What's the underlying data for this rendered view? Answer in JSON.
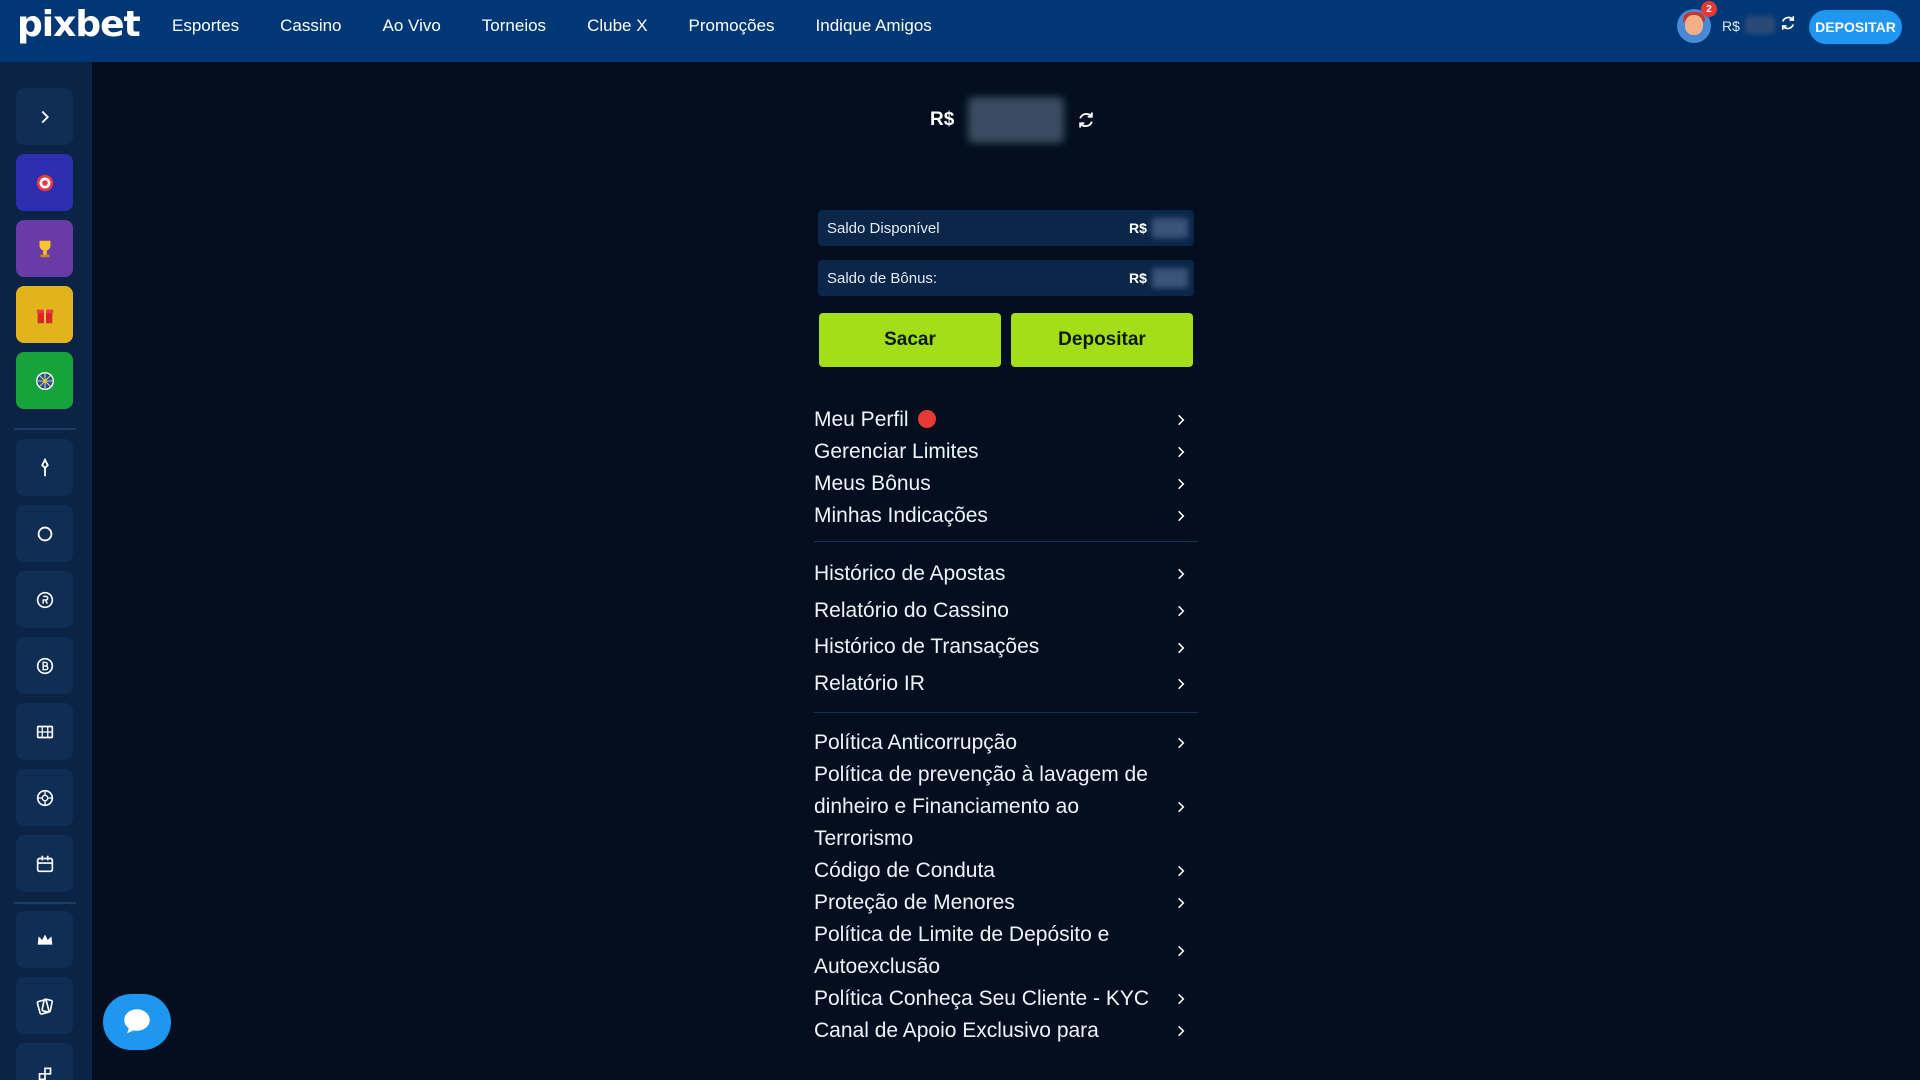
{
  "brand": {
    "logo_text": "pixbet"
  },
  "nav": {
    "items": [
      {
        "label": "Esportes"
      },
      {
        "label": "Cassino"
      },
      {
        "label": "Ao Vivo"
      },
      {
        "label": "Torneios"
      },
      {
        "label": "Clube X"
      },
      {
        "label": "Promoções"
      },
      {
        "label": "Indique Amigos"
      }
    ]
  },
  "header": {
    "notification_count": "2",
    "currency": "R$",
    "deposit_button": "DEPOSITAR"
  },
  "sidebar": {
    "icons": [
      "chevron-right-icon",
      "target-icon",
      "trophy-icon",
      "gift-icon",
      "roulette-icon",
      "pin-icon",
      "circle-icon",
      "r-coin-icon",
      "b-coin-icon",
      "bingo-icon",
      "wheel-icon",
      "calendar-icon",
      "crown-icon",
      "cards-icon"
    ]
  },
  "wallet": {
    "currency": "R$",
    "available_label": "Saldo Disponível",
    "bonus_label": "Saldo de Bônus:",
    "withdraw_button": "Sacar",
    "deposit_button": "Depositar"
  },
  "menu": {
    "group1": [
      {
        "label": "Meu Perfil"
      },
      {
        "label": "Gerenciar Limites"
      },
      {
        "label": "Meus Bônus"
      },
      {
        "label": "Minhas Indicações"
      }
    ],
    "group2": [
      {
        "label": "Histórico de Apostas"
      },
      {
        "label": "Relatório do Cassino"
      },
      {
        "label": "Histórico de Transações"
      },
      {
        "label": "Relatório IR"
      }
    ],
    "group3": [
      {
        "label": "Política Anticorrupção"
      },
      {
        "label": "Política de prevenção à lavagem de dinheiro e Financiamento ao Terrorismo"
      },
      {
        "label": "Código de Conduta"
      },
      {
        "label": "Proteção de Menores"
      },
      {
        "label": "Política de Limite de Depósito e Autoexclusão"
      },
      {
        "label": "Política Conheça Seu Cliente - KYC"
      },
      {
        "label": "Canal de Apoio Exclusivo para"
      }
    ]
  },
  "colors": {
    "topbar": "#003877",
    "background": "#030f1e",
    "sidebar": "#0b2445",
    "accent_green": "#a3de19",
    "accent_blue": "#1f96f0",
    "alert_red": "#e53935"
  }
}
